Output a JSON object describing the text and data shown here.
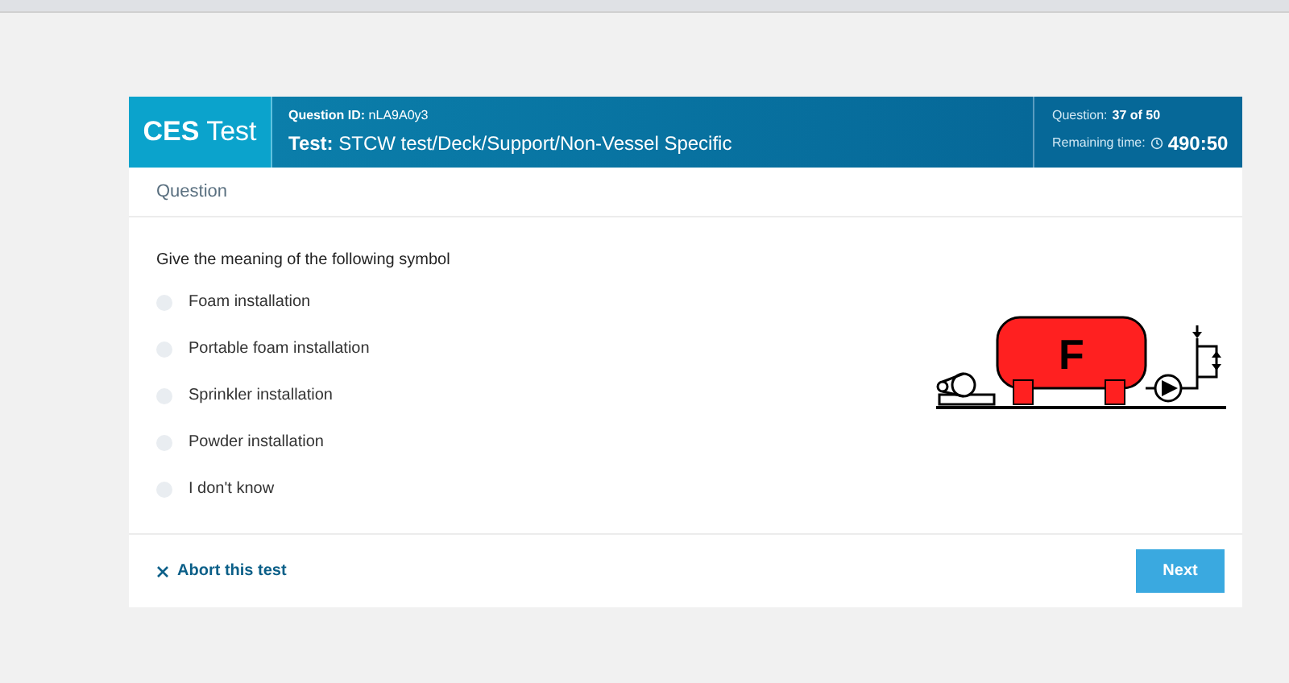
{
  "header": {
    "brand_bold": "CES",
    "brand_light": "Test",
    "question_id_label": "Question ID:",
    "question_id": "nLA9A0y3",
    "test_label": "Test:",
    "test_name": "STCW test/Deck/Support/Non-Vessel Specific",
    "progress_label": "Question:",
    "progress": "37 of 50",
    "time_label": "Remaining time:",
    "time": "490:50"
  },
  "section_title": "Question",
  "question": "Give the meaning of the following symbol",
  "options": [
    {
      "label": "Foam installation",
      "selected": false
    },
    {
      "label": "Portable foam installation",
      "selected": false
    },
    {
      "label": "Sprinkler installation",
      "selected": false
    },
    {
      "label": "Powder installation",
      "selected": false
    },
    {
      "label": "I don't know",
      "selected": false
    }
  ],
  "symbol_letter": "F",
  "abort": "Abort this test",
  "next": "Next"
}
